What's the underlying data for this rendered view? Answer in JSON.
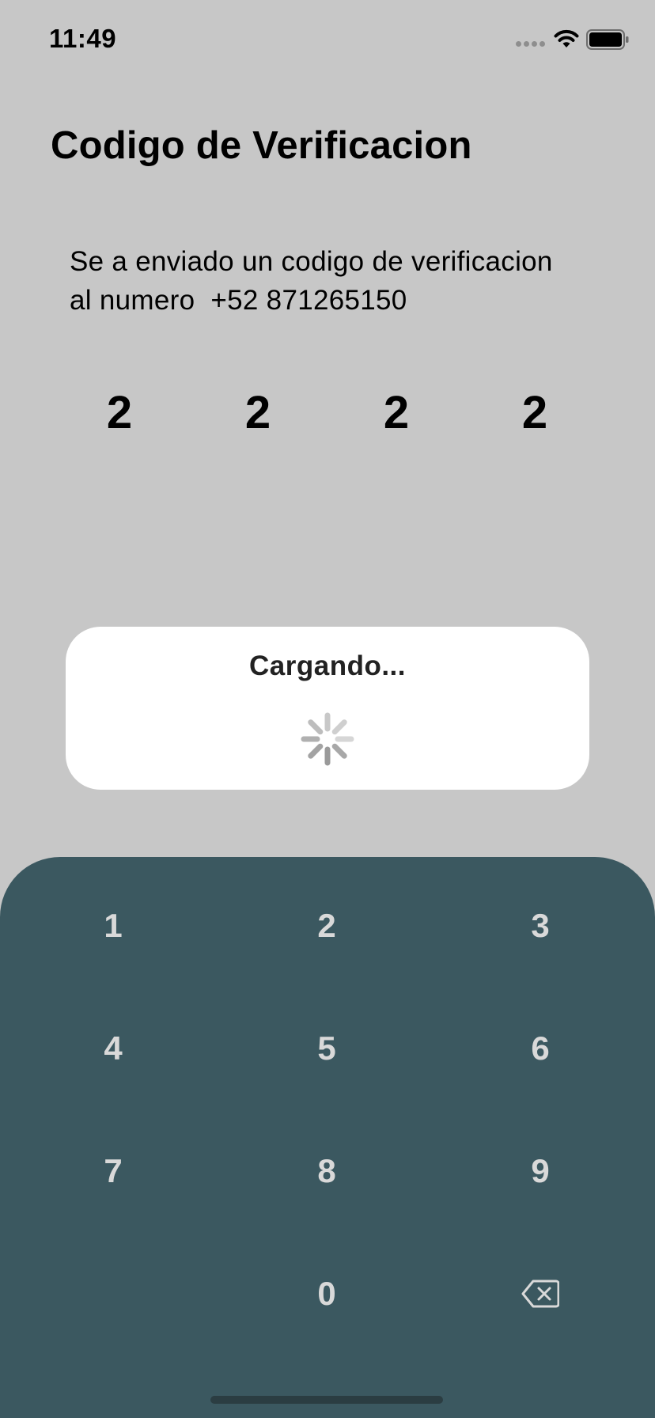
{
  "status_bar": {
    "time": "11:49",
    "icons": [
      "signal-dots-icon",
      "wifi-icon",
      "battery-icon"
    ]
  },
  "title": "Codigo de Verificacion",
  "description": {
    "line1": "Se a enviado un codigo de verificacion",
    "line2": "al numero  +52 871265150"
  },
  "code": [
    "2",
    "2",
    "2",
    "2"
  ],
  "loading": {
    "text": "Cargando...",
    "icon": "spinner-icon"
  },
  "keypad": {
    "keys": [
      "1",
      "2",
      "3",
      "4",
      "5",
      "6",
      "7",
      "8",
      "9",
      "0"
    ],
    "delete_icon": "backspace-icon"
  },
  "colors": {
    "background": "#c7c7c7",
    "keypad_background": "#3b5860",
    "keypad_text": "#d9d9d9",
    "card_background": "#ffffff"
  }
}
